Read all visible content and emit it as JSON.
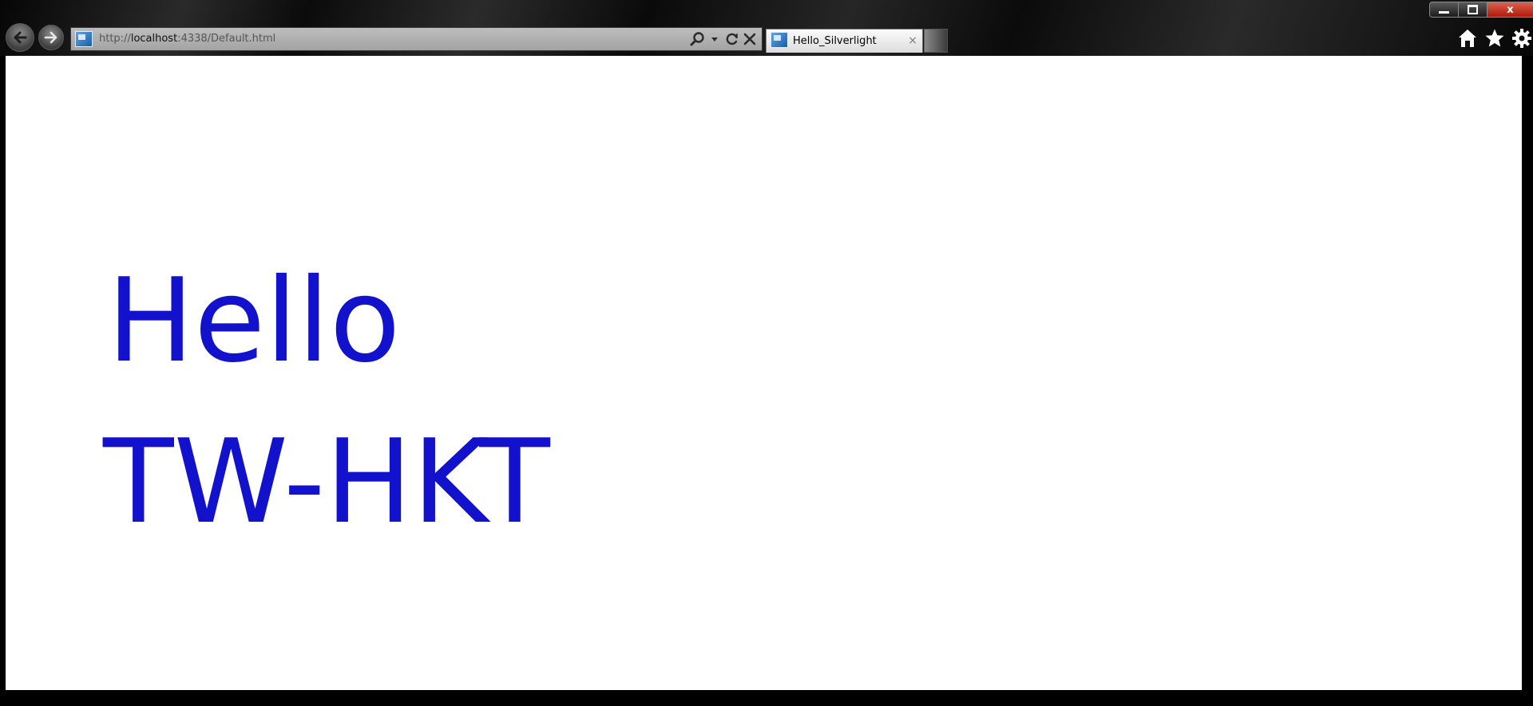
{
  "browser": {
    "address": {
      "scheme": "http://",
      "host": "localhost",
      "rest": ":4338/Default.html"
    },
    "tab": {
      "title": "Hello_Silverlight",
      "close_symbol": "×"
    },
    "icons": {
      "back": "back-arrow-icon",
      "forward": "forward-arrow-icon",
      "search": "search-icon",
      "dropdown": "chevron-down-icon",
      "refresh": "refresh-icon",
      "stop": "stop-icon",
      "home": "home-icon",
      "favorites": "star-icon",
      "tools": "gear-icon"
    },
    "window_controls": {
      "close_label": "x"
    }
  },
  "page": {
    "line1": "Hello",
    "line2": "TW-HKT",
    "text_color": "#1212cd"
  }
}
